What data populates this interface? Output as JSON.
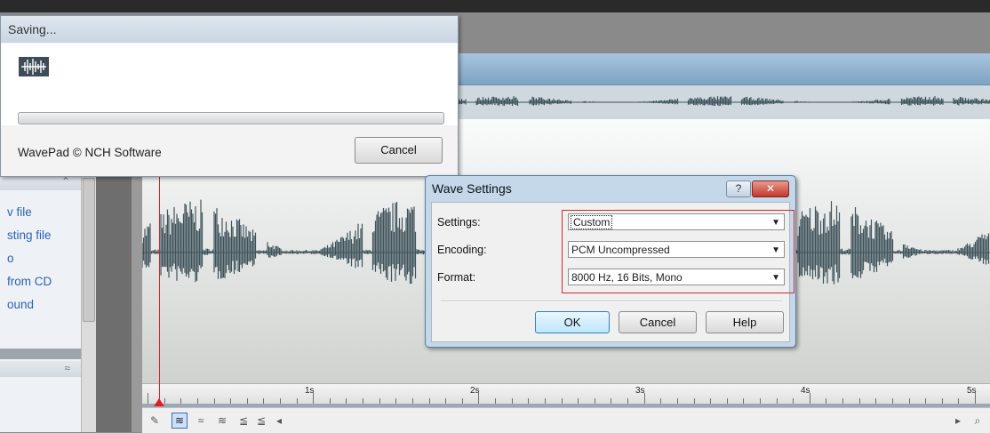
{
  "saving_dialog": {
    "title": "Saving...",
    "footer_text": "WavePad © NCH Software",
    "cancel_label": "Cancel",
    "progress": 0
  },
  "wave_settings": {
    "title": "Wave Settings",
    "help_icon": "?",
    "close_icon": "✕",
    "settings_label": "Settings:",
    "settings_value": "Custom",
    "encoding_label": "Encoding:",
    "encoding_value": "PCM Uncompressed",
    "format_label": "Format:",
    "format_value": "8000 Hz, 16 Bits, Mono",
    "ok_label": "OK",
    "cancel_label": "Cancel",
    "help_label": "Help"
  },
  "task_panel": {
    "items": [
      "v file",
      "sting file",
      "o",
      "from CD",
      "ound"
    ],
    "collapse_glyph": "⌃",
    "expand_glyph": "≈"
  },
  "timeline": {
    "labels": [
      "1s",
      "2s",
      "3s",
      "4s",
      "5s"
    ]
  },
  "colors": {
    "waveform": "#3f535b",
    "playhead": "#e02020",
    "highlight_frame": "#d12a2a",
    "link": "#2b63b6"
  },
  "icons": [
    "pencil-icon",
    "waveform-view-icon",
    "spectral-view-icon",
    "scroll-left-icon",
    "scroll-right-icon",
    "zoom-icon"
  ]
}
